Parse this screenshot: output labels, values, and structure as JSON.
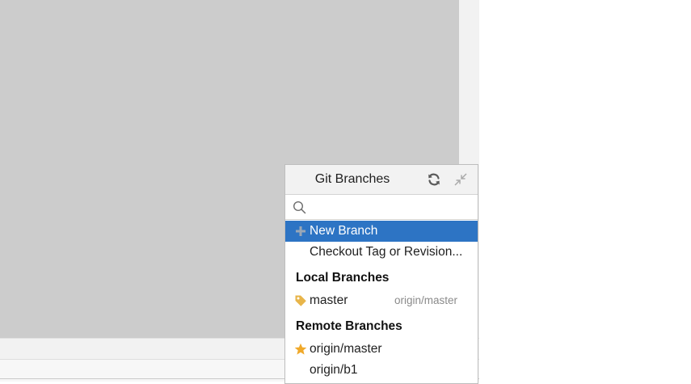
{
  "popup": {
    "title": "Git Branches",
    "header_icons": [
      "refresh-icon",
      "collapse-icon"
    ],
    "search": {
      "value": "",
      "placeholder": ""
    },
    "actions": [
      {
        "label": "New Branch",
        "icon": "plus-icon",
        "selected": true
      },
      {
        "label": "Checkout Tag or Revision...",
        "icon": "",
        "selected": false
      }
    ],
    "local_branches": {
      "header": "Local Branches",
      "items": [
        {
          "name": "master",
          "tracking": "origin/master",
          "icon": "tag-icon"
        }
      ]
    },
    "remote_branches": {
      "header": "Remote Branches",
      "items": [
        {
          "name": "origin/master",
          "icon": "star-icon"
        },
        {
          "name": "origin/b1",
          "icon": ""
        }
      ]
    }
  },
  "colors": {
    "selection": "#2d74c4",
    "tag": "#e8b54a",
    "star": "#f0a92a",
    "editor_bg": "#cccccc"
  }
}
